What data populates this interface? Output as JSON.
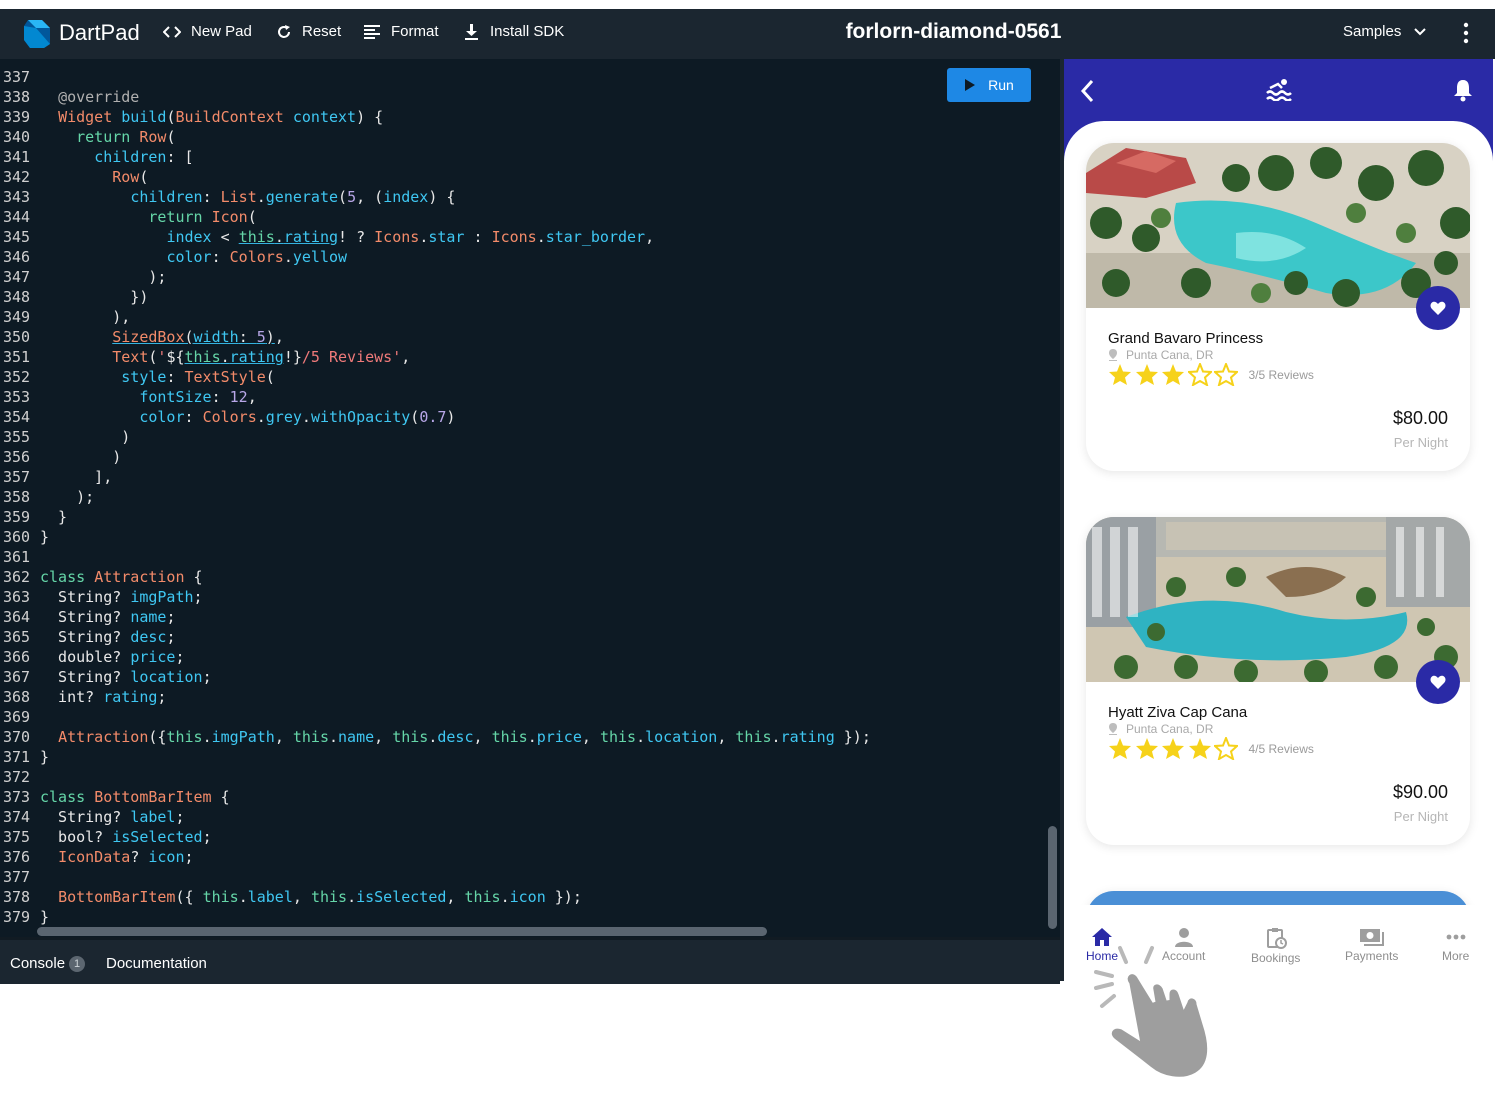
{
  "toolbar": {
    "brand": "DartPad",
    "new_pad": "New Pad",
    "reset": "Reset",
    "format": "Format",
    "install_sdk": "Install SDK",
    "pad_name": "forlorn-diamond-0561",
    "samples": "Samples"
  },
  "editor": {
    "run_label": "Run",
    "lines": [
      {
        "n": "337",
        "html": ""
      },
      {
        "n": "338",
        "html": "  <span class='c'>@override</span>"
      },
      {
        "n": "339",
        "html": "  <span class='t'>Widget</span> <span class='p'>build</span>(<span class='t'>BuildContext</span> <span class='p'>context</span>) {"
      },
      {
        "n": "340",
        "html": "    <span class='k'>return</span> <span class='t'>Row</span>("
      },
      {
        "n": "341",
        "html": "      <span class='p'>children</span>: ["
      },
      {
        "n": "342",
        "html": "        <span class='t'>Row</span>("
      },
      {
        "n": "343",
        "html": "          <span class='p'>children</span>: <span class='t'>List</span>.<span class='p'>generate</span>(<span class='n'>5</span>, (<span class='p'>index</span>) {"
      },
      {
        "n": "344",
        "html": "            <span class='k'>return</span> <span class='t'>Icon</span>("
      },
      {
        "n": "345",
        "html": "              <span class='p'>index</span> &lt; <span class='k u'>this</span><span class='u'>.</span><span class='p u'>rating</span>! ? <span class='t'>Icons</span>.<span class='p'>star</span> : <span class='t'>Icons</span>.<span class='p'>star_border</span>,"
      },
      {
        "n": "346",
        "html": "              <span class='p'>color</span>: <span class='t'>Colors</span>.<span class='p'>yellow</span>"
      },
      {
        "n": "347",
        "html": "            );"
      },
      {
        "n": "348",
        "html": "          })"
      },
      {
        "n": "349",
        "html": "        ),"
      },
      {
        "n": "350",
        "html": "        <span class='t u'>SizedBox</span><span class='u'>(</span><span class='p u'>width</span><span class='u'>: </span><span class='n u'>5</span><span class='u'>)</span>,"
      },
      {
        "n": "351",
        "html": "        <span class='t'>Text</span>(<span class='s'>'</span>${<span class='k u'>this</span><span class='u'>.</span><span class='p u'>rating</span>!}<span class='s'>/5 Reviews'</span>,"
      },
      {
        "n": "352",
        "html": "         <span class='p'>style</span>: <span class='t'>TextStyle</span>("
      },
      {
        "n": "353",
        "html": "           <span class='p'>fontSize</span>: <span class='n'>12</span>,"
      },
      {
        "n": "354",
        "html": "           <span class='p'>color</span>: <span class='t'>Colors</span>.<span class='p'>grey</span>.<span class='p'>withOpacity</span>(<span class='n'>0.7</span>)"
      },
      {
        "n": "355",
        "html": "         )"
      },
      {
        "n": "356",
        "html": "        )"
      },
      {
        "n": "357",
        "html": "      ],"
      },
      {
        "n": "358",
        "html": "    );"
      },
      {
        "n": "359",
        "html": "  }"
      },
      {
        "n": "360",
        "html": "}"
      },
      {
        "n": "361",
        "html": ""
      },
      {
        "n": "362",
        "html": "<span class='k'>class</span> <span class='t'>Attraction</span> {"
      },
      {
        "n": "363",
        "html": "  String? <span class='p'>imgPath</span>;"
      },
      {
        "n": "364",
        "html": "  String? <span class='p'>name</span>;"
      },
      {
        "n": "365",
        "html": "  String? <span class='p'>desc</span>;"
      },
      {
        "n": "366",
        "html": "  double? <span class='p'>price</span>;"
      },
      {
        "n": "367",
        "html": "  String? <span class='p'>location</span>;"
      },
      {
        "n": "368",
        "html": "  int? <span class='p'>rating</span>;"
      },
      {
        "n": "369",
        "html": ""
      },
      {
        "n": "370",
        "html": "  <span class='t'>Attraction</span>({<span class='k'>this</span>.<span class='p'>imgPath</span>, <span class='k'>this</span>.<span class='p'>name</span>, <span class='k'>this</span>.<span class='p'>desc</span>, <span class='k'>this</span>.<span class='p'>price</span>, <span class='k'>this</span>.<span class='p'>location</span>, <span class='k'>this</span>.<span class='p'>rating</span> });"
      },
      {
        "n": "371",
        "html": "}"
      },
      {
        "n": "372",
        "html": ""
      },
      {
        "n": "373",
        "html": "<span class='k'>class</span> <span class='t'>BottomBarItem</span> {"
      },
      {
        "n": "374",
        "html": "  String? <span class='p'>label</span>;"
      },
      {
        "n": "375",
        "html": "  bool? <span class='p'>isSelected</span>;"
      },
      {
        "n": "376",
        "html": "  <span class='t'>IconData</span>? <span class='p'>icon</span>;"
      },
      {
        "n": "377",
        "html": ""
      },
      {
        "n": "378",
        "html": "  <span class='t'>BottomBarItem</span>({ <span class='k'>this</span>.<span class='p'>label</span>, <span class='k'>this</span>.<span class='p'>isSelected</span>, <span class='k'>this</span>.<span class='p'>icon</span> });"
      },
      {
        "n": "379",
        "html": "}"
      }
    ]
  },
  "console": {
    "console_label": "Console",
    "console_count": "1",
    "documentation_label": "Documentation"
  },
  "preview": {
    "cards": [
      {
        "name": "Grand Bavaro Princess",
        "location": "Punta Cana, DR",
        "rating": 3,
        "reviews": "3/5 Reviews",
        "price": "$80.00",
        "per": "Per Night"
      },
      {
        "name": "Hyatt Ziva Cap Cana",
        "location": "Punta Cana, DR",
        "rating": 4,
        "reviews": "4/5 Reviews",
        "price": "$90.00",
        "per": "Per Night"
      }
    ],
    "nav": [
      {
        "label": "Home",
        "selected": true
      },
      {
        "label": "Account",
        "selected": false
      },
      {
        "label": "Bookings",
        "selected": false
      },
      {
        "label": "Payments",
        "selected": false
      },
      {
        "label": "More",
        "selected": false
      }
    ]
  },
  "colors": {
    "accent": "#2a2aa6",
    "star": "#f6d21a",
    "editor_bg": "#0d1a24",
    "toolbar_bg": "#1b2630",
    "run_button": "#1e88e5"
  }
}
